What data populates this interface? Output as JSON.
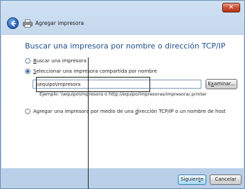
{
  "window": {
    "title": "Agregar impresora",
    "close_label": "✕"
  },
  "content": {
    "heading": "Buscar una impresora por nombre o dirección TCP/IP",
    "option_search": {
      "prefix": "",
      "accel": "B",
      "rest": "uscar una impresora",
      "checked": false
    },
    "option_shared": {
      "prefix": "",
      "accel": "S",
      "rest": "eleccionar una impresora compartida por nombre",
      "checked": true
    },
    "shared_input": {
      "value": "\\\\equipo\\impresora"
    },
    "example_text": "Ejemplo: \\\\equipo\\impresora o http://equipo/impresoras/impresora/.printer",
    "option_tcpip": {
      "prefix": "Agregar una impresora por medio de una ",
      "accel": "d",
      "rest": "irección TCP/IP o un nombre de host",
      "checked": false
    }
  },
  "buttons": {
    "browse": {
      "prefix": "E",
      "accel": "x",
      "rest": "aminar..."
    },
    "next": {
      "prefix": "Siguien",
      "accel": "t",
      "rest": "e"
    },
    "cancel": {
      "label": "Cancelar"
    }
  },
  "icons": [
    "back-arrow-icon",
    "printer-icon",
    "close-icon"
  ]
}
